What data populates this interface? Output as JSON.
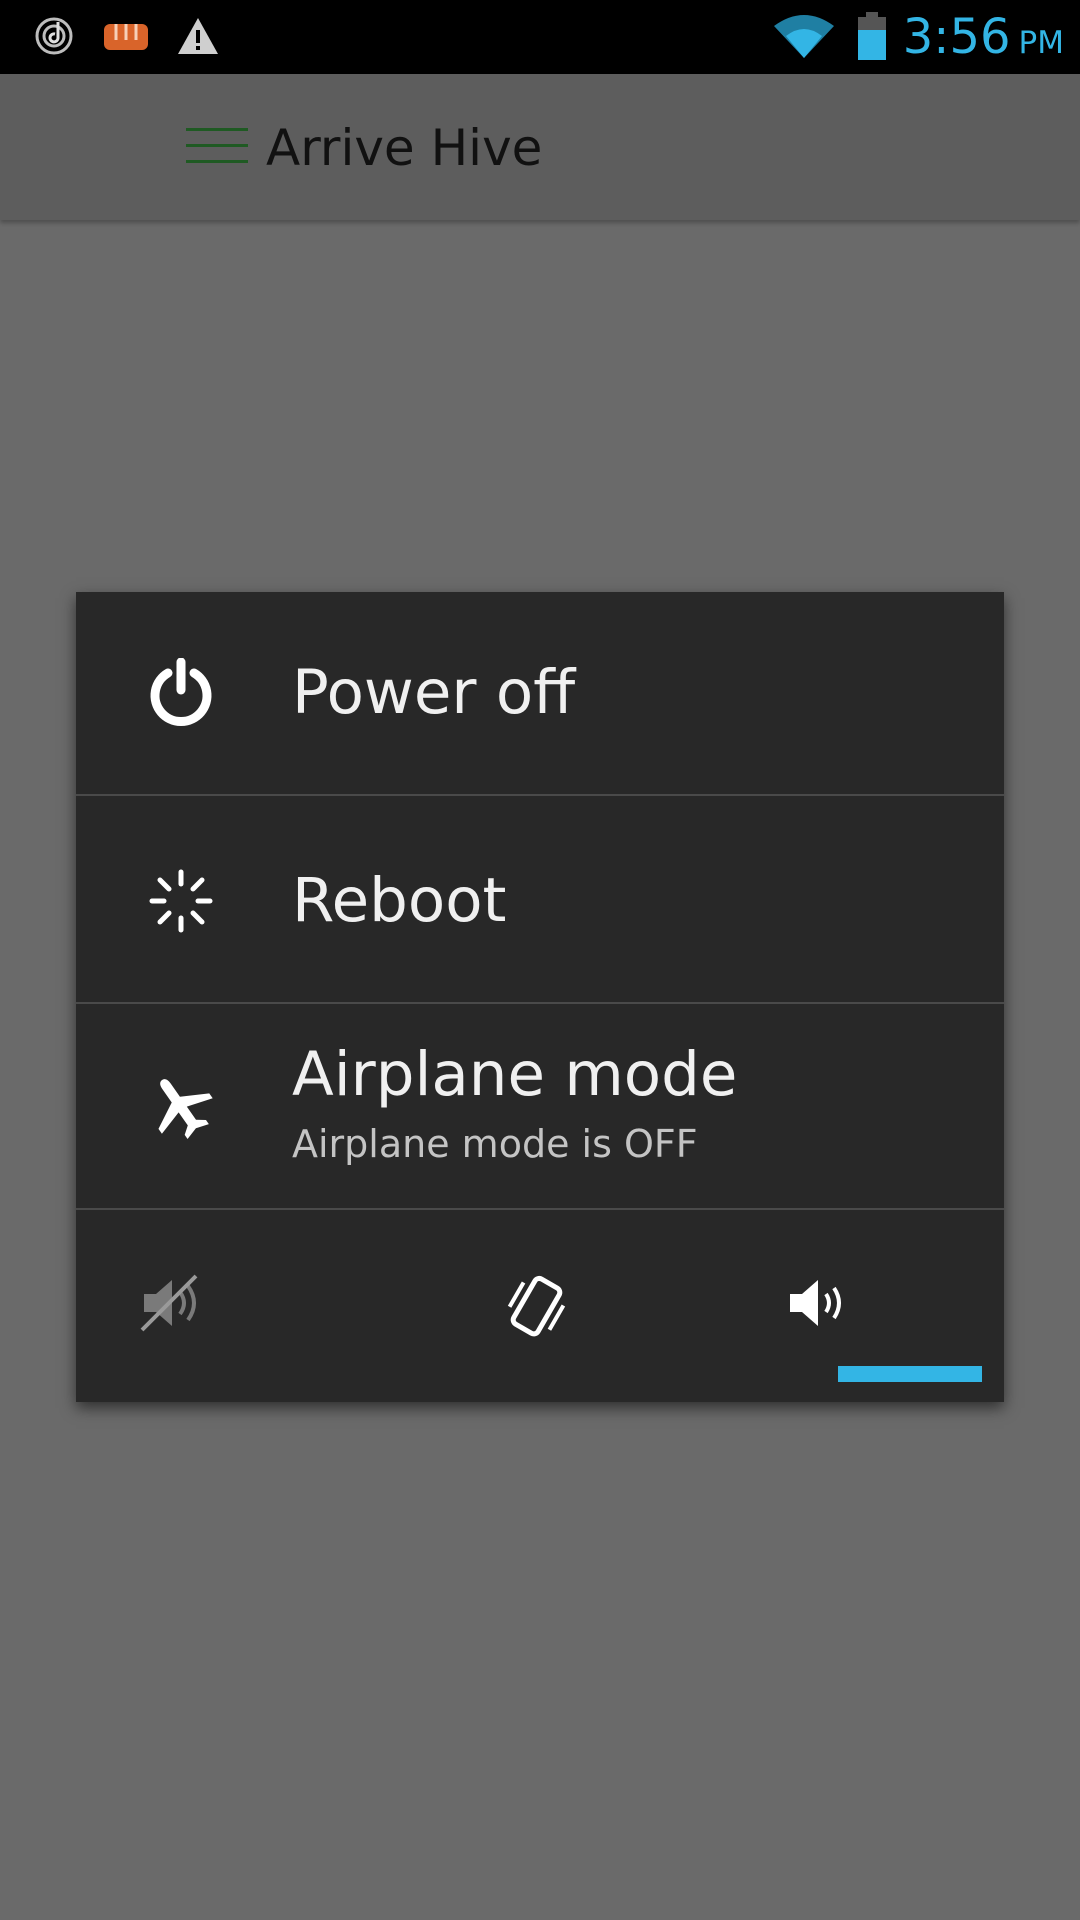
{
  "status_bar": {
    "time": "3:56",
    "ampm": "PM",
    "icons": [
      "music-radio-icon",
      "fist-icon",
      "warning-icon",
      "wifi-icon",
      "battery-icon"
    ],
    "accent_color": "#33b5e5"
  },
  "app_bar": {
    "title": "Arrive Hive",
    "menu_icon": "hamburger-menu-icon"
  },
  "power_dialog": {
    "items": [
      {
        "label": "Power off",
        "icon": "power-icon"
      },
      {
        "label": "Reboot",
        "icon": "reboot-spinner-icon"
      },
      {
        "label": "Airplane mode",
        "sublabel": "Airplane mode is OFF",
        "icon": "airplane-icon"
      }
    ],
    "sound_modes": [
      {
        "name": "silent",
        "icon": "sound-off-icon",
        "selected": false
      },
      {
        "name": "vibrate",
        "icon": "vibrate-icon",
        "selected": false
      },
      {
        "name": "sound",
        "icon": "sound-on-icon",
        "selected": true
      }
    ],
    "selection_color": "#33b5e5"
  }
}
